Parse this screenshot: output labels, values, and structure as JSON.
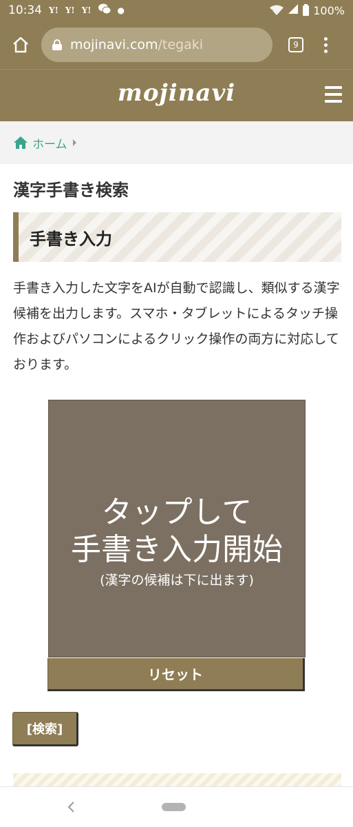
{
  "status_bar": {
    "time": "10:34",
    "notifications": [
      "Y!",
      "Y!",
      "Y!"
    ],
    "signal_label": "5",
    "battery": "100%"
  },
  "browser": {
    "url_domain": "mojinavi.com",
    "url_path": "/tegaki",
    "tab_count": "9"
  },
  "site": {
    "logo": "mojinavi"
  },
  "breadcrumb": {
    "home": "ホーム"
  },
  "page": {
    "title": "漢字手書き検索",
    "section_heading": "手書き入力",
    "description": "手書き入力した文字をAIが自動で認識し、類似する漢字候補を出力します。スマホ・タブレットによるタッチ操作およびパソコンによるクリック操作の両方に対応しております。"
  },
  "canvas": {
    "line1": "タップして",
    "line2": "手書き入力開始",
    "sub": "(漢字の候補は下に出ます)"
  },
  "buttons": {
    "reset": "リセット",
    "search": "[検索]"
  },
  "colors": {
    "brand": "#8f7e55",
    "canvas": "#7b7062",
    "link": "#3aa58c"
  }
}
